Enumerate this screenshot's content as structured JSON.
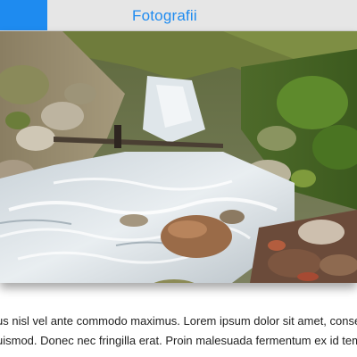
{
  "header": {
    "title": "Fotografii",
    "accent_color": "#1e8bf0",
    "background_color": "#e6e6e6"
  },
  "photo": {
    "icon": "photo-image",
    "subject": "forest-stream-with-rocks"
  },
  "body": {
    "lines": [
      "us nisl vel ante commodo maximus. Lorem ipsum dolor sit amet, consectetur adipiscing",
      "uismod. Donec nec fringilla erat. Proin malesuada fermentum ex id tempor. Aliquam e"
    ]
  }
}
